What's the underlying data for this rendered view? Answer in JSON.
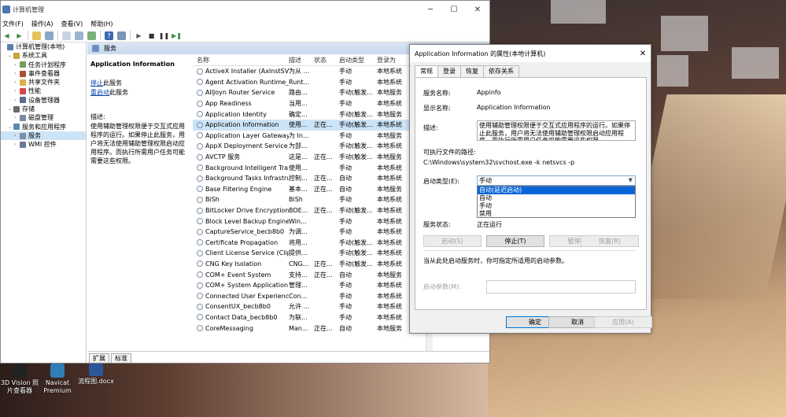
{
  "desktop": {
    "icons": [
      {
        "label": "3D Vision 照片查看器",
        "color": "#2a2a2a"
      },
      {
        "label": "Navicat Premium",
        "color": "#2f7fb5"
      },
      {
        "label": "流程图.docx",
        "color": "#2b579a"
      }
    ]
  },
  "window": {
    "title": "计算机管理",
    "min_icon": "minimize-icon",
    "max_icon": "maximize-icon",
    "close_icon": "close-icon"
  },
  "menu": [
    "文件(F)",
    "操作(A)",
    "查看(V)",
    "帮助(H)"
  ],
  "tree": [
    {
      "label": "计算机管理(本地)",
      "level": 0,
      "icon_color": "#5a7fb0"
    },
    {
      "label": "系统工具",
      "level": 1,
      "icon_color": "#c9a23a"
    },
    {
      "label": "任务计划程序",
      "level": 2,
      "icon_color": "#7a9a5a"
    },
    {
      "label": "事件查看器",
      "level": 2,
      "icon_color": "#b04a3a"
    },
    {
      "label": "共享文件夹",
      "level": 2,
      "icon_color": "#d9b24a"
    },
    {
      "label": "性能",
      "level": 2,
      "icon_color": "#d04a4a"
    },
    {
      "label": "设备管理器",
      "level": 2,
      "icon_color": "#5a6a8a"
    },
    {
      "label": "存储",
      "level": 1,
      "icon_color": "#6a6a6a"
    },
    {
      "label": "磁盘管理",
      "level": 2,
      "icon_color": "#7a8aa0"
    },
    {
      "label": "服务和应用程序",
      "level": 1,
      "icon_color": "#5a8ab0"
    },
    {
      "label": "服务",
      "level": 2,
      "icon_color": "#7d8ea6",
      "selected": true
    },
    {
      "label": "WMI 控件",
      "level": 2,
      "icon_color": "#6a7a9a"
    }
  ],
  "services_panel": {
    "header": "服务",
    "selected_name": "Application Information",
    "stop_link": "停止",
    "stop_suffix": "此服务",
    "restart_link": "重启动",
    "restart_suffix": "此服务",
    "desc_label": "描述:",
    "description": "使用辅助管理权限便于交互式应用程序的运行。如果停止此服务，用户将无法使用辅助管理权限启动应用程序。而执行所需用户任务可能需要这些权限。",
    "tabs": [
      "扩展",
      "标准"
    ]
  },
  "columns": [
    "名称",
    "描述",
    "状态",
    "启动类型",
    "登录为"
  ],
  "services": [
    [
      "ActiveX Installer (AxInstSV)",
      "为从 ...",
      "",
      "手动",
      "本地系统"
    ],
    [
      "Agent Activation Runtime_...",
      "Runt...",
      "",
      "手动",
      "本地系统"
    ],
    [
      "AllJoyn Router Service",
      "路由...",
      "",
      "手动(触发...",
      "本地服务"
    ],
    [
      "App Readiness",
      "当用...",
      "",
      "手动",
      "本地系统"
    ],
    [
      "Application Identity",
      "确定...",
      "",
      "手动(触发...",
      "本地服务"
    ],
    [
      "Application Information",
      "使用...",
      "正在...",
      "手动(触发...",
      "本地系统"
    ],
    [
      "Application Layer Gateway ...",
      "为 In...",
      "",
      "手动",
      "本地服务"
    ],
    [
      "AppX Deployment Service ...",
      "为部...",
      "",
      "手动(触发...",
      "本地系统"
    ],
    [
      "AVCTP 服务",
      "这是...",
      "正在...",
      "手动(触发...",
      "本地服务"
    ],
    [
      "Background Intelligent Tra...",
      "使用...",
      "",
      "手动",
      "本地系统"
    ],
    [
      "Background Tasks Infrastru...",
      "控制...",
      "正在...",
      "自动",
      "本地系统"
    ],
    [
      "Base Filtering Engine",
      "基本...",
      "正在...",
      "自动",
      "本地服务"
    ],
    [
      "BiSh",
      "BiSh",
      "",
      "手动",
      "本地系统"
    ],
    [
      "BitLocker Drive Encryption ...",
      "BDE...",
      "正在...",
      "手动(触发...",
      "本地系统"
    ],
    [
      "Block Level Backup Engine ...",
      "Win...",
      "",
      "手动",
      "本地系统"
    ],
    [
      "CaptureService_becb8b0",
      "为调...",
      "",
      "手动",
      "本地系统"
    ],
    [
      "Certificate Propagation",
      "将用...",
      "",
      "手动(触发...",
      "本地系统"
    ],
    [
      "Client License Service (Clip...",
      "提供...",
      "",
      "手动(触发...",
      "本地系统"
    ],
    [
      "CNG Key Isolation",
      "CNG...",
      "正在...",
      "手动(触发...",
      "本地系统"
    ],
    [
      "COM+ Event System",
      "支持...",
      "正在...",
      "自动",
      "本地服务"
    ],
    [
      "COM+ System Application",
      "管理...",
      "",
      "手动",
      "本地系统"
    ],
    [
      "Connected User Experienc...",
      "Con...",
      "",
      "手动",
      "本地系统"
    ],
    [
      "ConsentUX_becb8b0",
      "允许 ...",
      "",
      "手动",
      "本地系统"
    ],
    [
      "Contact Data_becb8b0",
      "为联...",
      "",
      "手动",
      "本地系统"
    ],
    [
      "CoreMessaging",
      "Man...",
      "正在...",
      "自动",
      "本地服务"
    ]
  ],
  "dialog": {
    "title": "Application Information 的属性(本地计算机)",
    "tabs": [
      "常规",
      "登录",
      "恢复",
      "依存关系"
    ],
    "service_name_label": "服务名称:",
    "service_name": "Appinfo",
    "display_name_label": "显示名称:",
    "display_name": "Application Information",
    "desc_label": "描述:",
    "description": "使用辅助管理权限便于交互式应用程序的运行。如果停止此服务，用户将无法使用辅助管理权限启动应用程序。而执行所需用户任务可能需要这些权限。",
    "path_label": "可执行文件的路径:",
    "path": "C:\\Windows\\system32\\svchost.exe -k netsvcs -p",
    "startup_label": "启动类型(E):",
    "startup_value": "手动",
    "startup_options": [
      "自动(延迟启动)",
      "自动",
      "手动",
      "禁用"
    ],
    "status_label": "服务状态:",
    "status": "正在运行",
    "btn_start": "启动(S)",
    "btn_stop": "停止(T)",
    "btn_pause": "暂停(P)",
    "btn_resume": "恢复(R)",
    "hint": "当从此处启动服务时，你可指定所适用的启动参数。",
    "params_label": "启动参数(M):",
    "ok": "确定",
    "cancel": "取消",
    "apply": "应用(A)"
  }
}
